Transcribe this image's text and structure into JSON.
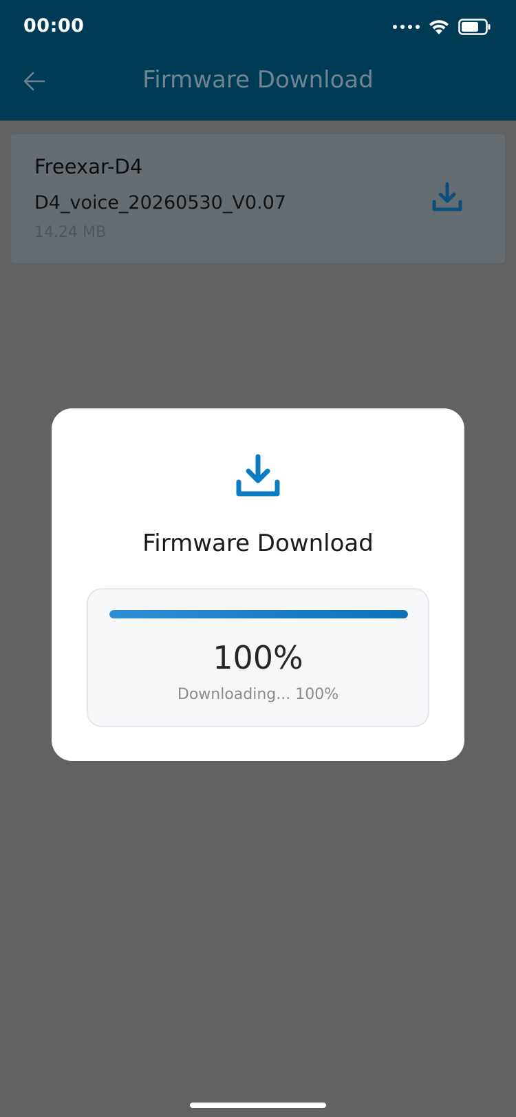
{
  "status_bar": {
    "time": "00:00",
    "signal_icon": "signal-dots-icon",
    "wifi_icon": "wifi-icon",
    "battery_icon": "battery-icon"
  },
  "header": {
    "title": "Firmware Download",
    "back_icon": "back-arrow-icon",
    "background_color": "#003b56"
  },
  "firmware_list": [
    {
      "name": "Freexar-D4",
      "file": "D4_voice_20260530_V0.07",
      "size": "14.24 MB",
      "action_icon": "download-icon"
    }
  ],
  "dialog": {
    "icon": "download-icon",
    "title": "Firmware Download",
    "progress": 1.0,
    "percent_text": "100%",
    "status_text": "Downloading... 100%",
    "accent_color": "#0a7cc4"
  },
  "overlay": {
    "scrim_color": "#626262"
  }
}
